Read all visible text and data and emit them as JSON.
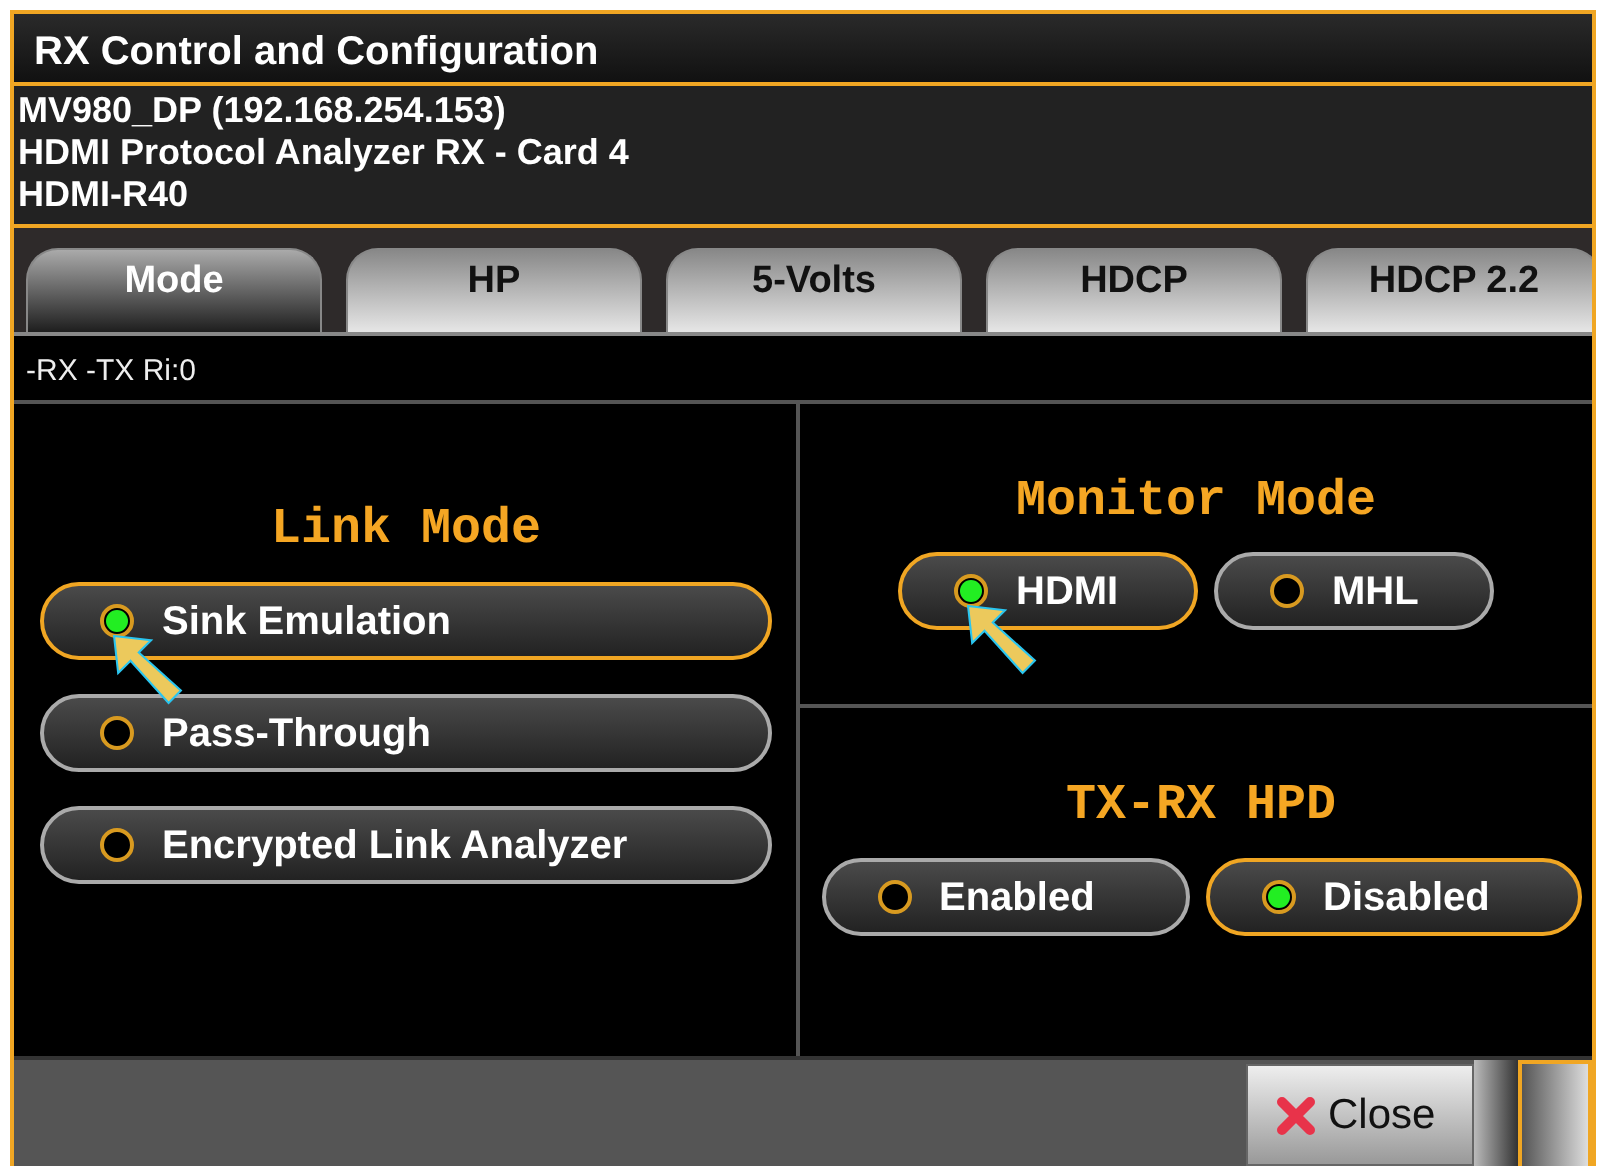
{
  "window": {
    "title": "RX Control and Configuration"
  },
  "info_lines": [
    "MV980_DP (192.168.254.153)",
    "HDMI Protocol Analyzer RX - Card 4",
    "HDMI-R40"
  ],
  "tabs": [
    {
      "label": "Mode",
      "selected": true
    },
    {
      "label": "HP",
      "selected": false
    },
    {
      "label": "5-Volts",
      "selected": false
    },
    {
      "label": "HDCP",
      "selected": false
    },
    {
      "label": "HDCP 2.2",
      "selected": false
    }
  ],
  "status_line": "-RX -TX Ri:0",
  "link_mode": {
    "title": "Link Mode",
    "annotated": true,
    "options": [
      {
        "label": "Sink Emulation",
        "selected": true
      },
      {
        "label": "Pass-Through",
        "selected": false
      },
      {
        "label": "Encrypted Link Analyzer",
        "selected": false
      }
    ]
  },
  "monitor_mode": {
    "title": "Monitor Mode",
    "annotated": true,
    "options": [
      {
        "label": "HDMI",
        "selected": true
      },
      {
        "label": "MHL",
        "selected": false
      }
    ]
  },
  "tx_rx_hpd": {
    "title": "TX-RX HPD",
    "annotated": false,
    "options": [
      {
        "label": "Enabled",
        "selected": false
      },
      {
        "label": "Disabled",
        "selected": true
      }
    ]
  },
  "buttons": [
    {
      "label": "Close"
    }
  ]
}
